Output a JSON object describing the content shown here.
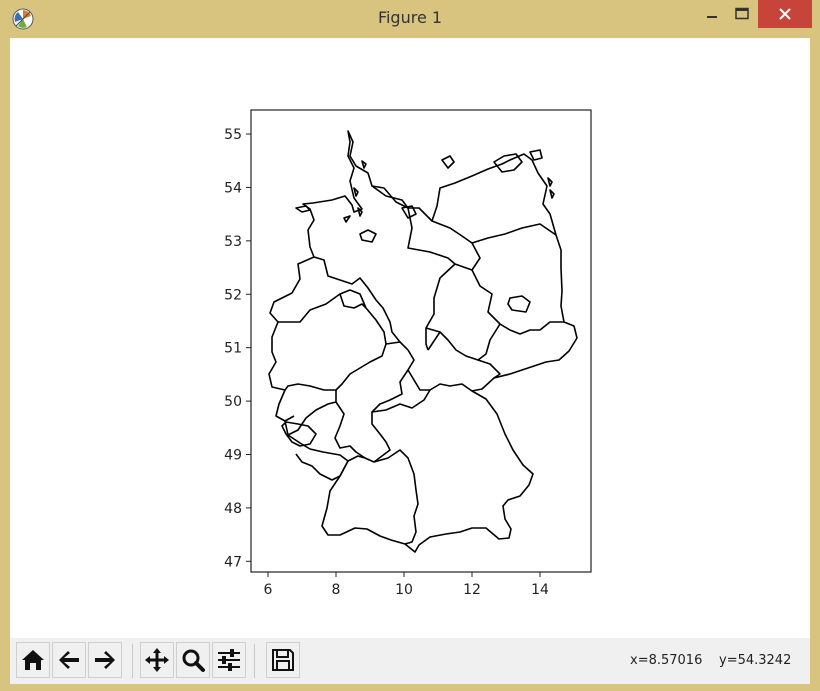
{
  "window": {
    "title": "Figure 1",
    "app_icon": "matplotlib-icon",
    "controls": [
      "minimize-icon",
      "maximize-icon",
      "close-icon"
    ]
  },
  "plot": {
    "x_ticks": [
      "6",
      "8",
      "10",
      "12",
      "14"
    ],
    "y_ticks": [
      "47",
      "48",
      "49",
      "50",
      "51",
      "52",
      "53",
      "54",
      "55"
    ],
    "xlim": [
      5.5,
      15.5
    ],
    "ylim": [
      46.8,
      55.45
    ],
    "content": "map outlines of German federal states"
  },
  "toolbar": {
    "buttons": [
      {
        "icon": "home-icon"
      },
      {
        "icon": "back-arrow-icon"
      },
      {
        "icon": "forward-arrow-icon"
      },
      {
        "icon": "pan-icon"
      },
      {
        "icon": "zoom-icon"
      },
      {
        "icon": "configure-subplots-icon"
      },
      {
        "icon": "save-icon"
      }
    ],
    "x_readout": "x=8.57016",
    "y_readout": "y=54.3242"
  }
}
